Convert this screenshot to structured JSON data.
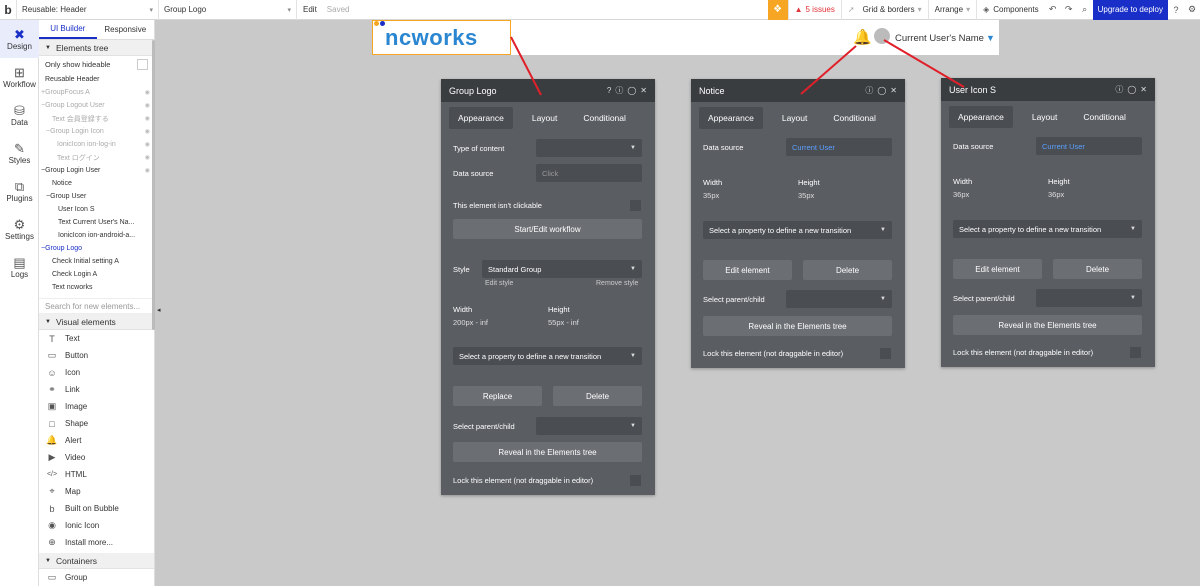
{
  "topbar": {
    "page_select": "Reusable: Header",
    "element_select": "Group Logo",
    "edit_label": "Edit",
    "saved_label": "Saved",
    "issues_label": "5 issues",
    "grid_label": "Grid & borders",
    "arrange_label": "Arrange",
    "components_label": "Components",
    "upgrade_label": "Upgrade to deploy"
  },
  "rail": [
    {
      "label": "Design",
      "icon": "design-icon"
    },
    {
      "label": "Workflow",
      "icon": "workflow-icon"
    },
    {
      "label": "Data",
      "icon": "data-icon"
    },
    {
      "label": "Styles",
      "icon": "styles-icon"
    },
    {
      "label": "Plugins",
      "icon": "plugins-icon"
    },
    {
      "label": "Settings",
      "icon": "settings-icon"
    },
    {
      "label": "Logs",
      "icon": "logs-icon"
    }
  ],
  "panel": {
    "tab_ui": "UI Builder",
    "tab_responsive": "Responsive",
    "elements_tree": "Elements tree",
    "only_hideable": "Only show hideable",
    "tree": [
      "Reusable Header",
      "GroupFocus A",
      "Group Logout User",
      "Text 会員登録する",
      "Group Login Icon",
      "IonicIcon ion-log-in",
      "Text ログイン",
      "Group Login User",
      "Notice",
      "Group User",
      "User Icon S",
      "Text Current User's Na...",
      "IonicIcon ion-android-a...",
      "Group Logo",
      "Check Initial setting A",
      "Check Login A",
      "Text ncworks"
    ],
    "search_placeholder": "Search for new elements...",
    "visual_elements": "Visual elements",
    "visual": [
      {
        "label": "Text",
        "icon": "T"
      },
      {
        "label": "Button",
        "icon": "▭"
      },
      {
        "label": "Icon",
        "icon": "☺"
      },
      {
        "label": "Link",
        "icon": "⚭"
      },
      {
        "label": "Image",
        "icon": "▣"
      },
      {
        "label": "Shape",
        "icon": "□"
      },
      {
        "label": "Alert",
        "icon": "🔔"
      },
      {
        "label": "Video",
        "icon": "▶"
      },
      {
        "label": "HTML",
        "icon": "</>"
      },
      {
        "label": "Map",
        "icon": "⌖"
      },
      {
        "label": "Built on Bubble",
        "icon": "b"
      },
      {
        "label": "Ionic Icon",
        "icon": "◉"
      },
      {
        "label": "Install more...",
        "icon": "⊕"
      }
    ],
    "containers": "Containers",
    "group_label": "Group"
  },
  "canvas": {
    "logo_text": "ncworks",
    "user_name": "Current User's Name"
  },
  "insp_logo": {
    "title": "Group Logo",
    "tab_appearance": "Appearance",
    "tab_layout": "Layout",
    "tab_conditional": "Conditional",
    "type_of_content": "Type of content",
    "data_source": "Data source",
    "click_placeholder": "Click",
    "not_clickable": "This element isn't clickable",
    "workflow_btn": "Start/Edit workflow",
    "style_label": "Style",
    "style_value": "Standard Group",
    "edit_style": "Edit style",
    "remove_style": "Remove style",
    "width_label": "Width",
    "width_value": "200px - inf",
    "height_label": "Height",
    "height_value": "55px - inf",
    "transition": "Select a property to define a new transition",
    "replace": "Replace",
    "delete": "Delete",
    "parent_child": "Select parent/child",
    "reveal": "Reveal in the Elements tree",
    "lock": "Lock this element (not draggable in editor)"
  },
  "insp_notice": {
    "title": "Notice",
    "tab_appearance": "Appearance",
    "tab_layout": "Layout",
    "tab_conditional": "Conditional",
    "data_source": "Data source",
    "data_source_value": "Current User",
    "width_label": "Width",
    "width_value": "35px",
    "height_label": "Height",
    "height_value": "35px",
    "transition": "Select a property to define a new transition",
    "edit_element": "Edit element",
    "delete": "Delete",
    "parent_child": "Select parent/child",
    "reveal": "Reveal in the Elements tree",
    "lock": "Lock this element (not draggable in editor)"
  },
  "insp_user": {
    "title": "User Icon S",
    "tab_appearance": "Appearance",
    "tab_layout": "Layout",
    "tab_conditional": "Conditional",
    "data_source": "Data source",
    "data_source_value": "Current User",
    "width_label": "Width",
    "width_value": "36px",
    "height_label": "Height",
    "height_value": "36px",
    "transition": "Select a property to define a new transition",
    "edit_element": "Edit element",
    "delete": "Delete",
    "parent_child": "Select parent/child",
    "reveal": "Reveal in the Elements tree",
    "lock": "Lock this element (not draggable in editor)"
  },
  "colors": {
    "accent": "#1a2fc7",
    "logo": "#2a86d1",
    "bell": "#f5a623",
    "arrow": "#e0202a"
  }
}
